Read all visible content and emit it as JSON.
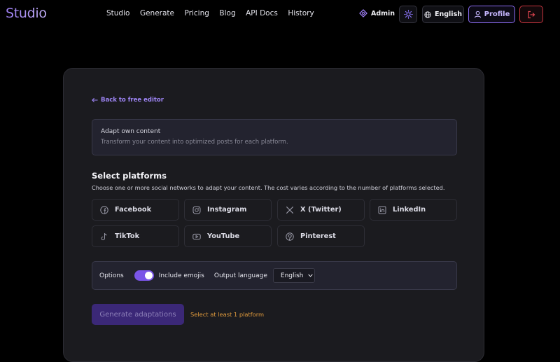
{
  "app": {
    "logo": "Studio"
  },
  "nav": [
    "Studio",
    "Generate",
    "Pricing",
    "Blog",
    "API Docs",
    "History"
  ],
  "header": {
    "admin_label": "Admin",
    "language_label": "English",
    "profile_label": "Profile"
  },
  "card": {
    "back_label": "Back to free editor",
    "info_title": "Adapt own content",
    "info_subtitle": "Transform your content into optimized posts for each platform.",
    "section_title": "Select platforms",
    "section_desc": "Choose one or more social networks to adapt your content. The cost varies according to the number of platforms selected.",
    "platforms": [
      {
        "label": "Facebook",
        "icon": "facebook-icon"
      },
      {
        "label": "Instagram",
        "icon": "instagram-icon"
      },
      {
        "label": "X (Twitter)",
        "icon": "x-icon"
      },
      {
        "label": "LinkedIn",
        "icon": "linkedin-icon"
      },
      {
        "label": "TikTok",
        "icon": "tiktok-icon"
      },
      {
        "label": "YouTube",
        "icon": "youtube-icon"
      },
      {
        "label": "Pinterest",
        "icon": "pinterest-icon"
      }
    ],
    "options": {
      "label": "Options",
      "include_emojis_label": "Include emojis",
      "include_emojis": true,
      "output_language_label": "Output language",
      "output_language_value": "English"
    },
    "generate_label": "Generate adaptations",
    "warning": "Select at least 1 platform"
  },
  "colors": {
    "accent": "#7a55e8",
    "warning": "#e19b3c",
    "logout_border": "#c5343e"
  }
}
